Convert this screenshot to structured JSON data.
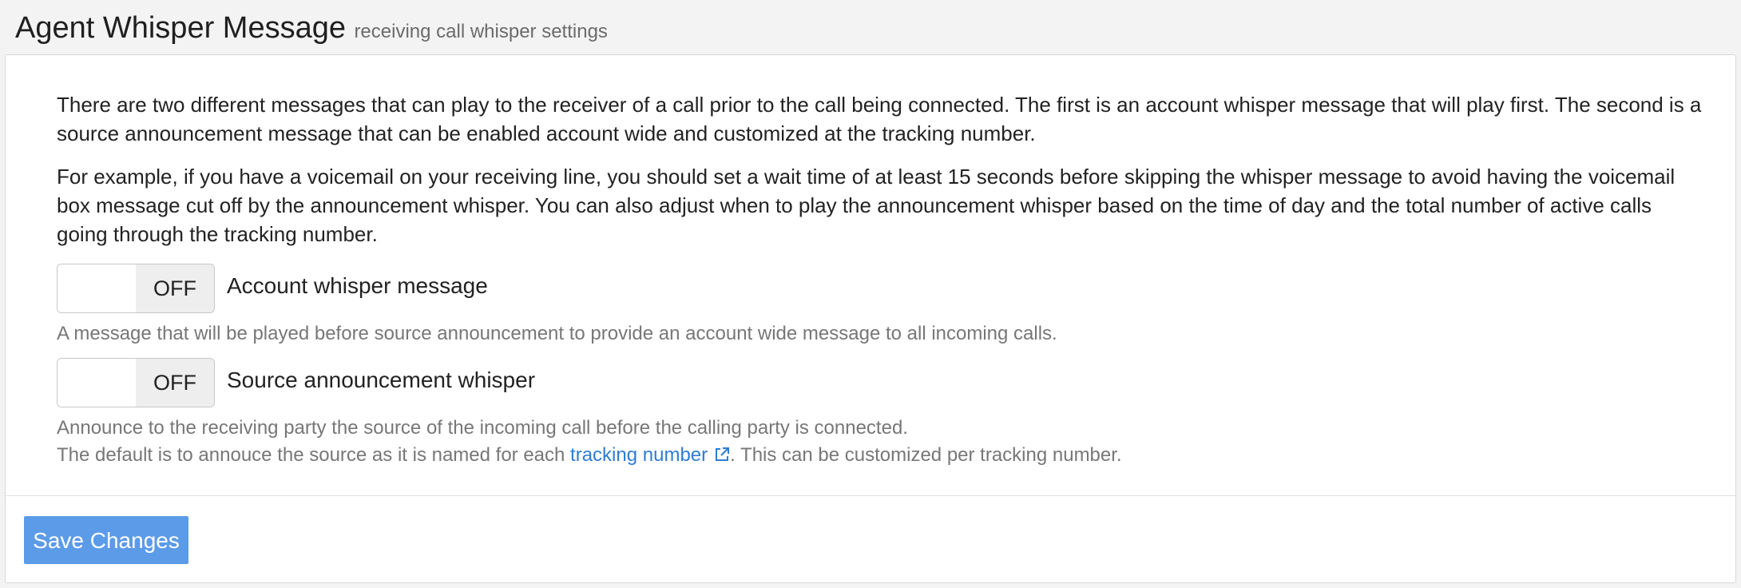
{
  "header": {
    "title": "Agent Whisper Message",
    "subtitle": "receiving call whisper settings"
  },
  "intro": {
    "paragraph_1": "There are two different messages that can play to the receiver of a call prior to the call being connected. The first is an account whisper message that will play first. The second is a source announcement message that can be enabled account wide and customized at the tracking number.",
    "paragraph_2": "For example, if you have a voicemail on your receiving line, you should set a wait time of at least 15 seconds before skipping the whisper message to avoid having the voicemail box message cut off by the announcement whisper. You can also adjust when to play the announcement whisper based on the time of day and the total number of active calls going through the tracking number."
  },
  "settings": [
    {
      "toggle_state": "OFF",
      "label": "Account whisper message",
      "help": "A message that will be played before source announcement to provide an account wide message to all incoming calls."
    },
    {
      "toggle_state": "OFF",
      "label": "Source announcement whisper",
      "help_line_1": "Announce to the receiving party the source of the incoming call before the calling party is connected.",
      "help_line_2_prefix": "The default is to annouce the source as it is named for each ",
      "help_line_2_link": "tracking number",
      "help_line_2_suffix": ". This can be customized per tracking number."
    }
  ],
  "footer": {
    "save_label": "Save Changes"
  },
  "colors": {
    "link": "#2d7cd4",
    "save_button": "#5b9be8",
    "help_text": "#777777"
  },
  "icons": {
    "link_icon": "external-link-icon"
  }
}
